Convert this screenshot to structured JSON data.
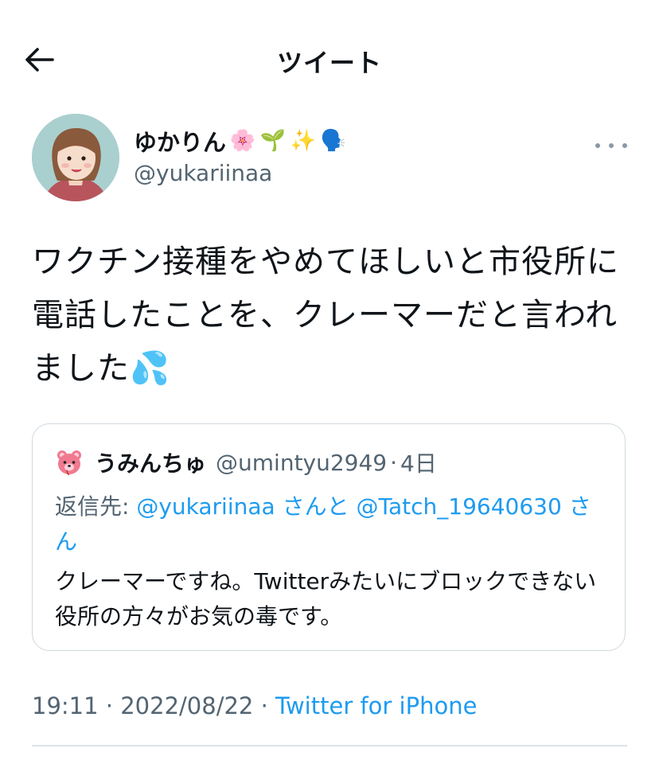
{
  "header": {
    "title": "ツイート"
  },
  "tweet": {
    "author": {
      "display_name": "ゆかりん",
      "name_emojis": [
        "🌸",
        "🌱",
        "✨",
        "🗣️"
      ],
      "handle": "@yukariinaa"
    },
    "text": "ワクチン接種をやめてほしいと市役所に電話したことを、クレーマーだと言われました💦",
    "quoted": {
      "author_name": "うみんちゅ",
      "author_handle": "@umintyu2949",
      "separator": "·",
      "time": "4日",
      "reply_prefix": "返信先: ",
      "reply_mention_1": "@yukariinaa",
      "reply_joiner": "さんと",
      "reply_mention_2": "@Tatch_19640630",
      "reply_suffix": "さん",
      "text": "クレーマーですね。Twitterみたいにブロックできない役所の方々がお気の毒です。"
    },
    "meta": {
      "time": "19:11",
      "sep1": " · ",
      "date": "2022/08/22",
      "sep2": " · ",
      "source": "Twitter for iPhone"
    }
  },
  "colors": {
    "link": "#1d9bf0",
    "secondary": "#536471",
    "border": "#cfd9de"
  },
  "icons": {
    "back": "arrow-left-icon",
    "more": "more-dots-icon"
  }
}
